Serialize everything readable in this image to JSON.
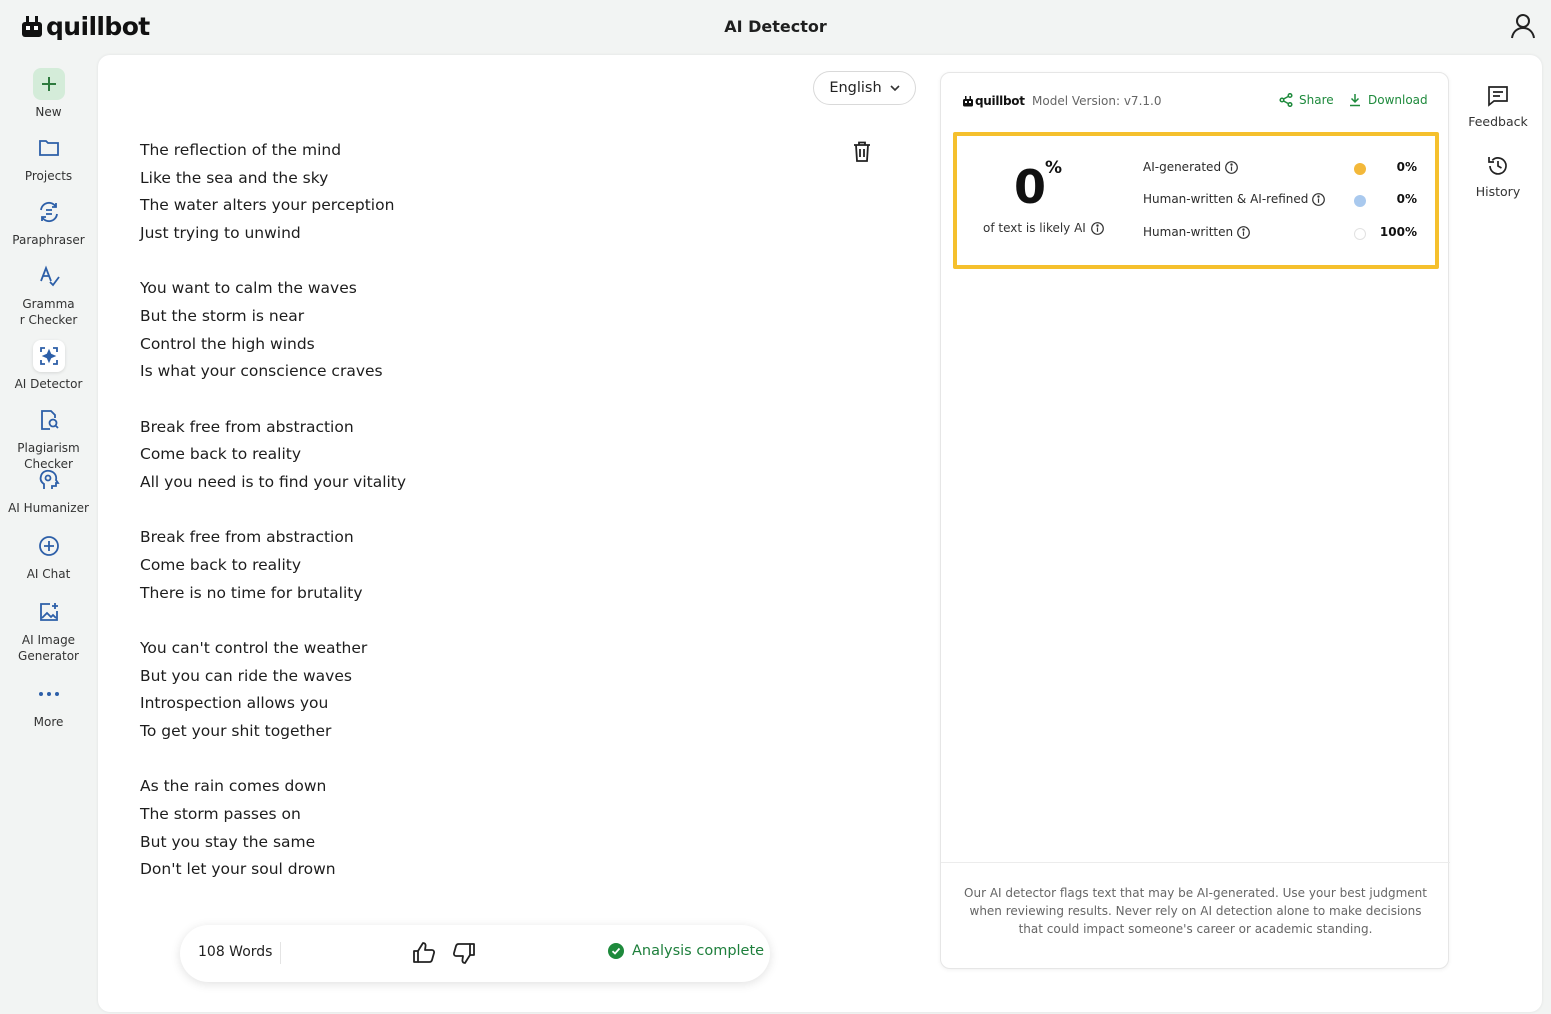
{
  "app": {
    "logo_text": "quillbot",
    "page_title": "AI Detector"
  },
  "nav": {
    "items": [
      {
        "label": "New",
        "icon": "plus-icon"
      },
      {
        "label": "Projects",
        "icon": "folder-icon"
      },
      {
        "label": "Paraphraser",
        "icon": "paraphraser-icon"
      },
      {
        "label": "Gramma\nr Checker",
        "icon": "grammar-icon"
      },
      {
        "label": "AI Detector",
        "icon": "ai-detector-icon"
      },
      {
        "label": "Plagiarism\nChecker",
        "icon": "plagiarism-icon"
      },
      {
        "label": "AI Humanizer",
        "icon": "humanizer-icon"
      },
      {
        "label": "AI Chat",
        "icon": "chat-icon"
      },
      {
        "label": "AI Image\nGenerator",
        "icon": "image-generator-icon"
      },
      {
        "label": "More",
        "icon": "more-icon"
      }
    ]
  },
  "editor": {
    "language": "English",
    "stanzas": [
      [
        "The reflection of the mind",
        "Like the sea and the sky",
        "The water alters your perception",
        "Just trying to unwind"
      ],
      [
        "You want to calm the waves",
        "But the storm is near",
        "Control the high winds",
        "Is what your conscience craves"
      ],
      [
        "Break free from abstraction",
        "Come back to reality",
        "All you need is to find your vitality"
      ],
      [
        "Break free from abstraction",
        "Come back to reality",
        "There is no time for brutality"
      ],
      [
        "You can't control the weather",
        "But you can ride the waves",
        "Introspection allows you",
        "To get your shit together"
      ],
      [
        "As the rain comes down",
        "The storm passes on",
        "But you stay the same",
        "Don't let your soul drown"
      ]
    ],
    "word_count": "108 Words",
    "status": "Analysis complete"
  },
  "results": {
    "logo_text": "quillbot",
    "model_version": "Model Version: v7.1.0",
    "share_label": "Share",
    "download_label": "Download",
    "score_value": "0",
    "score_unit": "%",
    "score_caption": "of text is likely AI",
    "breakdown": [
      {
        "label": "AI-generated",
        "value": "0%",
        "color": "#f3b83a"
      },
      {
        "label": "Human-written & AI-refined",
        "value": "0%",
        "color": "#a9c9ee"
      },
      {
        "label": "Human-written",
        "value": "100%",
        "color": "#ffffff"
      }
    ],
    "disclaimer": "Our AI detector flags text that may be AI-generated. Use your best judgment when reviewing results. Never rely on AI detection alone to make decisions that could impact someone's career or academic standing."
  },
  "rail": {
    "feedback_label": "Feedback",
    "history_label": "History"
  },
  "colors": {
    "accent_green": "#1e8a3c",
    "highlight_yellow": "#f5c02d",
    "background": "#f2f4f3"
  }
}
